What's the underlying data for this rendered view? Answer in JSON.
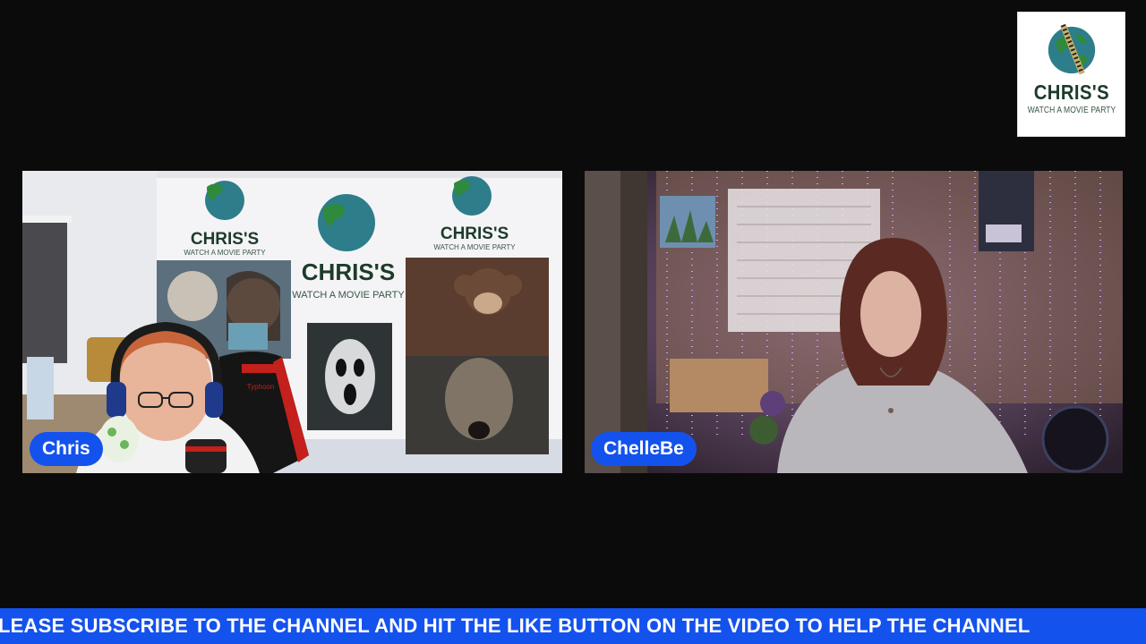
{
  "logo": {
    "wordmark": "CHRIS'S",
    "tagline": "WATCH A MOVIE PARTY"
  },
  "participants": [
    {
      "name": "Chris"
    },
    {
      "name": "ChelleBe"
    }
  ],
  "scene_text": {
    "poster_wordmark": "CHRIS'S",
    "poster_tagline": "WATCH A MOVIE PARTY",
    "chair_brand": "Typhoon"
  },
  "ticker": {
    "text": "LEASE SUBSCRIBE TO THE CHANNEL AND HIT THE LIKE BUTTON ON THE VIDEO TO HELP THE CHANNEL"
  },
  "colors": {
    "background": "#0b0b0b",
    "accent_blue": "#1452ee",
    "logo_green": "#1d3b2a"
  }
}
